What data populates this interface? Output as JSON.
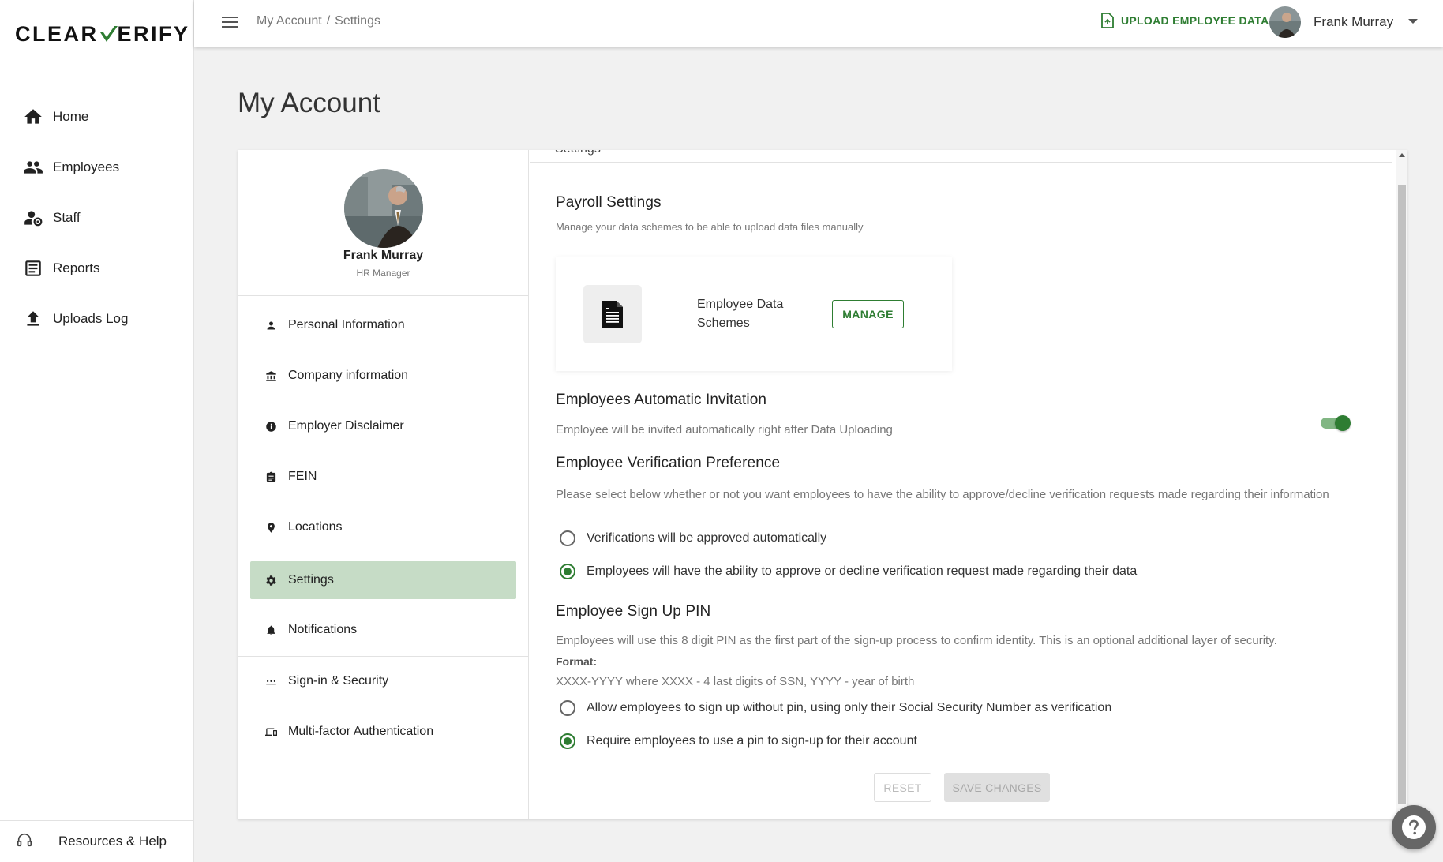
{
  "brand": {
    "logo_left": "CLEAR",
    "logo_right": "ERIFY",
    "accent": "#2e7d32"
  },
  "sidebar": {
    "items": [
      {
        "label": "Home",
        "icon": "home-icon"
      },
      {
        "label": "Employees",
        "icon": "people-icon"
      },
      {
        "label": "Staff",
        "icon": "staff-settings-icon"
      },
      {
        "label": "Reports",
        "icon": "report-icon"
      },
      {
        "label": "Uploads Log",
        "icon": "upload-icon"
      }
    ],
    "resources_label": "Resources & Help"
  },
  "topbar": {
    "breadcrumb": [
      "My Account",
      "Settings"
    ],
    "upload_label": "UPLOAD EMPLOYEE DATA",
    "user_name": "Frank Murray"
  },
  "page": {
    "title": "My Account"
  },
  "profile": {
    "name": "Frank Murray",
    "role": "HR Manager",
    "menu": [
      {
        "label": "Personal Information",
        "icon": "person-icon"
      },
      {
        "label": "Company information",
        "icon": "bank-icon"
      },
      {
        "label": "Employer Disclaimer",
        "icon": "info-icon"
      },
      {
        "label": "FEIN",
        "icon": "clipboard-icon"
      },
      {
        "label": "Locations",
        "icon": "location-pin-icon"
      },
      {
        "label": "Settings",
        "icon": "gear-icon",
        "active": true
      },
      {
        "label": "Notifications",
        "icon": "bell-icon"
      },
      {
        "label": "Sign-in & Security",
        "icon": "password-dots-icon"
      },
      {
        "label": "Multi-factor Authentication",
        "icon": "devices-icon"
      }
    ]
  },
  "settings": {
    "header": "Settings",
    "payroll": {
      "title": "Payroll Settings",
      "subtitle": "Manage your data schemes to be able to upload data files manually",
      "schema_label": "Employee Data Schemes",
      "manage_label": "MANAGE"
    },
    "auto_invite": {
      "title": "Employees Automatic Invitation",
      "subtitle": "Employee will be invited automatically right after Data Uploading",
      "enabled": true
    },
    "verification": {
      "title": "Employee Verification Preference",
      "subtitle": "Please select below whether or not you want employees to have the ability to approve/decline verification requests made regarding their information",
      "options": [
        {
          "label": "Verifications will be approved automatically",
          "selected": false
        },
        {
          "label": "Employees will have the ability to approve or decline verification request made regarding their data",
          "selected": true
        }
      ]
    },
    "pin": {
      "title": "Employee Sign Up PIN",
      "subtitle": "Employees will use this 8 digit PIN as the first part of the sign-up process to confirm identity. This is an optional additional layer of security.",
      "format_label": "Format:",
      "format_value": "XXXX-YYYY where XXXX - 4 last digits of SSN, YYYY - year of birth",
      "options": [
        {
          "label": "Allow employees to sign up without pin, using only their Social Security Number as verification",
          "selected": false
        },
        {
          "label": "Require employees to use a pin to sign-up for their account",
          "selected": true
        }
      ]
    },
    "reset_label": "RESET",
    "save_label": "SAVE CHANGES"
  }
}
